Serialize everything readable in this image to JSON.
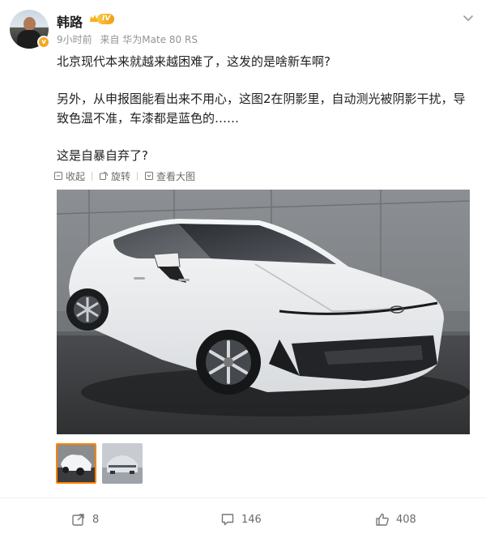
{
  "author": {
    "name": "韩路",
    "level_badge": "IV",
    "verified_badge": "v"
  },
  "meta": {
    "time": "9小时前",
    "source": "来自 华为Mate 80 RS"
  },
  "content": {
    "paragraphs": [
      "北京现代本来就越来越困难了，这发的是啥新车啊?",
      "另外，从申报图能看出来不用心，这图2在阴影里，自动测光被阴影干扰，导致色温不准，车漆都是蓝色的……",
      "这是自暴自弃了?"
    ]
  },
  "image_tools": {
    "collapse": "收起",
    "rotate": "旋转",
    "view_large": "查看大图"
  },
  "thumbnails": [
    {
      "icon": "white-car-front-photo"
    },
    {
      "icon": "bluish-car-rear-photo"
    }
  ],
  "actions": {
    "repost_count": "8",
    "comment_count": "146",
    "like_count": "408"
  },
  "colors": {
    "accent": "#ff8200",
    "meta_gray": "#939393",
    "badge_gold": "#f5a623"
  }
}
